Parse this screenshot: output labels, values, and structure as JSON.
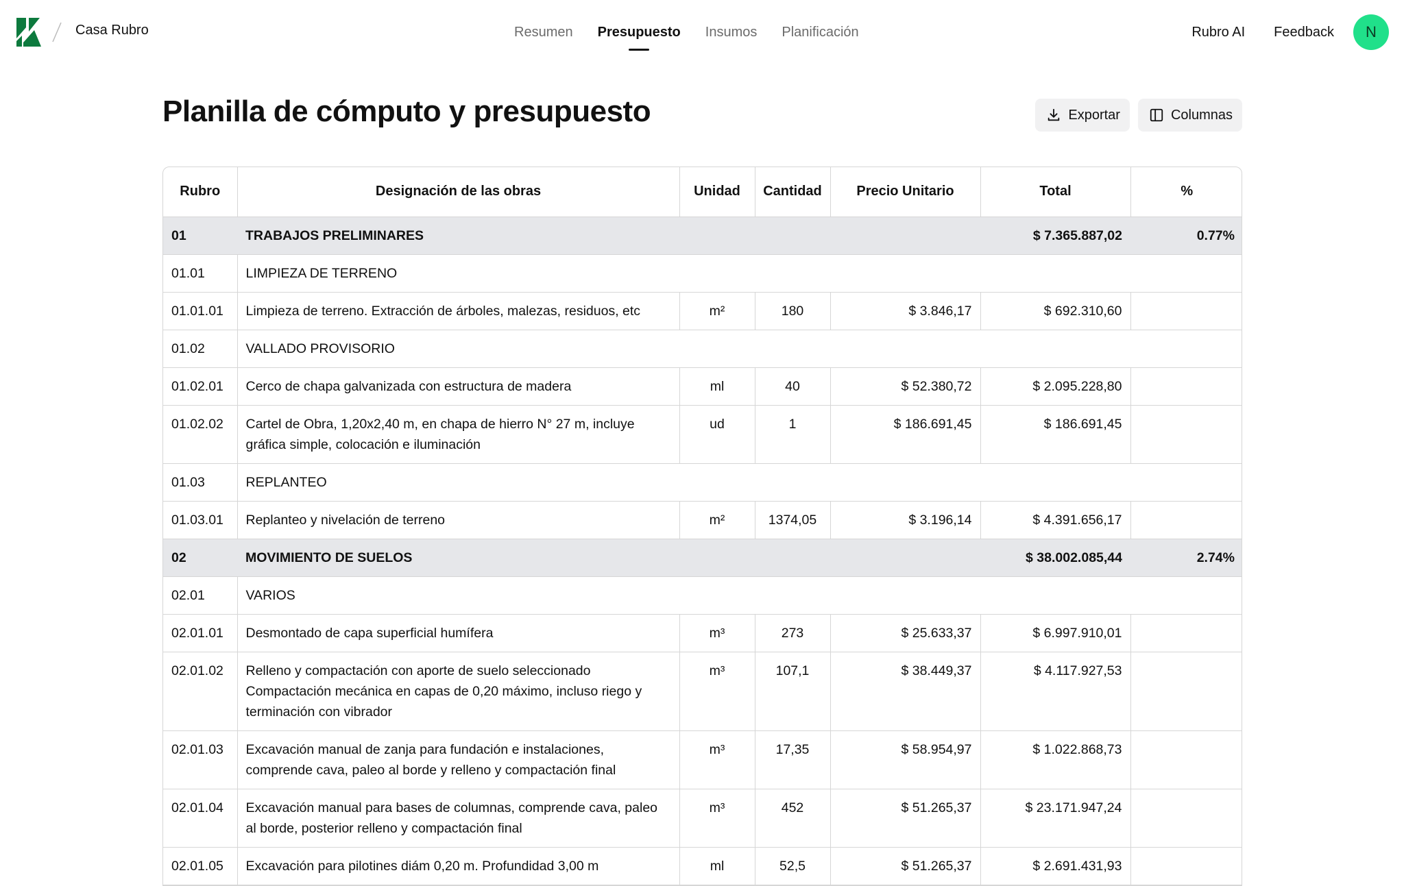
{
  "nav": {
    "project": "Casa Rubro",
    "tabs": [
      {
        "label": "Resumen"
      },
      {
        "label": "Presupuesto"
      },
      {
        "label": "Insumos"
      },
      {
        "label": "Planificación"
      }
    ],
    "active_tab": "Presupuesto",
    "ai_label": "Rubro AI",
    "feedback_label": "Feedback",
    "avatar_initial": "N",
    "colors": {
      "brand": "#0d7a3e",
      "avatar": "#20e08a"
    }
  },
  "header": {
    "title": "Planilla de cómputo y presupuesto",
    "export_label": "Exportar",
    "columns_label": "Columnas"
  },
  "table": {
    "columns": [
      "Rubro",
      "Designación de las obras",
      "Unidad",
      "Cantidad",
      "Precio Unitario",
      "Total",
      "%"
    ],
    "rows": [
      {
        "type": "section",
        "code": "01",
        "name": "TRABAJOS PRELIMINARES",
        "total": "$ 7.365.887,02",
        "percent": "0.77%"
      },
      {
        "type": "subsection",
        "code": "01.01",
        "name": "LIMPIEZA DE TERRENO"
      },
      {
        "type": "item",
        "code": "01.01.01",
        "name": "Limpieza de terreno. Extracción de árboles, malezas, residuos, etc",
        "unit": "m²",
        "qty": "180",
        "price": "$ 3.846,17",
        "total": "$ 692.310,60",
        "percent": ""
      },
      {
        "type": "subsection",
        "code": "01.02",
        "name": "VALLADO PROVISORIO"
      },
      {
        "type": "item",
        "code": "01.02.01",
        "name": "Cerco de chapa galvanizada con estructura de madera",
        "unit": "ml",
        "qty": "40",
        "price": "$ 52.380,72",
        "total": "$ 2.095.228,80",
        "percent": ""
      },
      {
        "type": "item",
        "code": "01.02.02",
        "name": "Cartel de Obra, 1,20x2,40 m, en chapa de hierro N° 27 m, incluye gráfica simple, colocación e iluminación",
        "unit": "ud",
        "qty": "1",
        "price": "$ 186.691,45",
        "total": "$ 186.691,45",
        "percent": ""
      },
      {
        "type": "subsection",
        "code": "01.03",
        "name": "REPLANTEO"
      },
      {
        "type": "item",
        "code": "01.03.01",
        "name": "Replanteo y nivelación de terreno",
        "unit": "m²",
        "qty": "1374,05",
        "price": "$ 3.196,14",
        "total": "$ 4.391.656,17",
        "percent": ""
      },
      {
        "type": "section",
        "code": "02",
        "name": "MOVIMIENTO DE SUELOS",
        "total": "$ 38.002.085,44",
        "percent": "2.74%"
      },
      {
        "type": "subsection",
        "code": "02.01",
        "name": "VARIOS"
      },
      {
        "type": "item",
        "code": "02.01.01",
        "name": "Desmontado de capa superficial humífera",
        "unit": "m³",
        "qty": "273",
        "price": "$ 25.633,37",
        "total": "$ 6.997.910,01",
        "percent": ""
      },
      {
        "type": "item",
        "code": "02.01.02",
        "name": "Relleno y compactación con aporte de suelo seleccionado Compactación mecánica en capas de 0,20 máximo, incluso riego y terminación con vibrador",
        "unit": "m³",
        "qty": "107,1",
        "price": "$ 38.449,37",
        "total": "$ 4.117.927,53",
        "percent": ""
      },
      {
        "type": "item",
        "code": "02.01.03",
        "name": "Excavación manual de zanja para fundación e instalaciones, comprende cava, paleo al borde y relleno y compactación final",
        "unit": "m³",
        "qty": "17,35",
        "price": "$ 58.954,97",
        "total": "$ 1.022.868,73",
        "percent": ""
      },
      {
        "type": "item",
        "code": "02.01.04",
        "name": "Excavación manual para bases de columnas, comprende cava, paleo al borde, posterior relleno y compactación final",
        "unit": "m³",
        "qty": "452",
        "price": "$ 51.265,37",
        "total": "$ 23.171.947,24",
        "percent": ""
      },
      {
        "type": "item",
        "code": "02.01.05",
        "name": "Excavación para pilotines diám 0,20 m. Profundidad 3,00 m",
        "unit": "ml",
        "qty": "52,5",
        "price": "$ 51.265,37",
        "total": "$ 2.691.431,93",
        "percent": ""
      }
    ]
  }
}
